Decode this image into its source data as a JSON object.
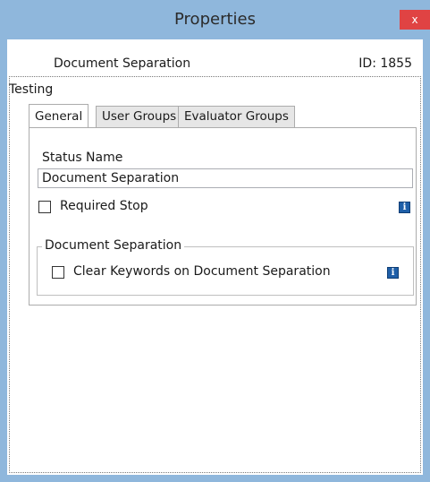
{
  "window": {
    "title": "Properties",
    "close_label": "x"
  },
  "header": {
    "document_name": "Document Separation",
    "id_text": "ID: 1855"
  },
  "panel": {
    "label": "Testing"
  },
  "tabs": [
    {
      "label": "General",
      "active": true
    },
    {
      "label": "User Groups",
      "active": false
    },
    {
      "label": "Evaluator Groups",
      "active": false
    }
  ],
  "general": {
    "status_name_label": "Status Name",
    "status_name_value": "Document Separation",
    "required_stop": {
      "label": "Required Stop",
      "checked": false
    },
    "separation_group": {
      "legend": "Document Separation",
      "clear_keywords": {
        "label": "Clear Keywords on Document Separation",
        "checked": false
      }
    }
  },
  "icons": {
    "info": "info-icon",
    "info_glyph": "i"
  },
  "colors": {
    "titlebar": "#8fb7dc",
    "close_button": "#e04343",
    "info_icon": "#1f5fa8"
  }
}
